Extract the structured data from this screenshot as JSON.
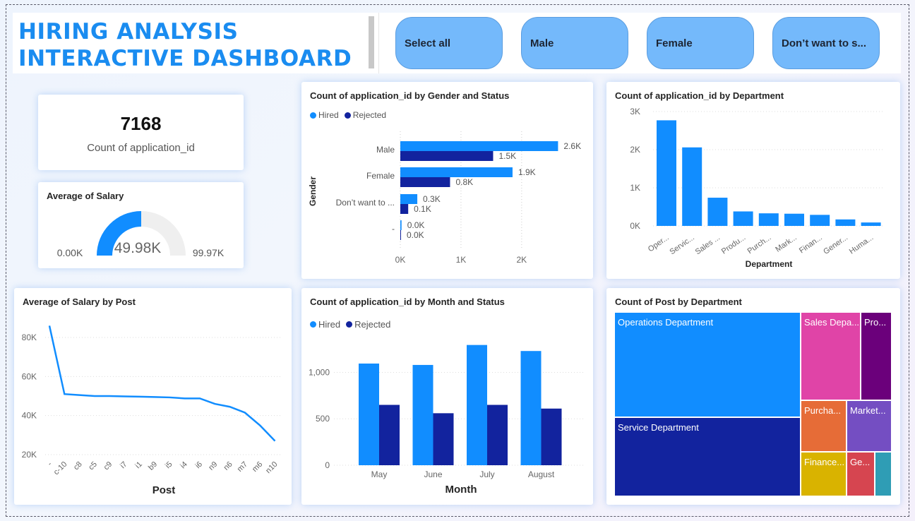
{
  "header": {
    "title_line1": "HIRING ANALYSIS",
    "title_line2": "INTERACTIVE DASHBOARD",
    "slicers": [
      "Select all",
      "Male",
      "Female",
      "Don’t want to s..."
    ]
  },
  "kpi": {
    "value": "7168",
    "label": "Count of application_id"
  },
  "colors": {
    "hired": "#118dff",
    "rejected": "#12239e",
    "accent": "#1a8cf0",
    "gauge_track": "#efefef"
  },
  "chart_data": [
    {
      "type": "gauge",
      "title": "Average of Salary",
      "value": 49.98,
      "min": 0,
      "max": 99.97,
      "value_label": "49.98K",
      "min_label": "0.00K",
      "max_label": "99.97K"
    },
    {
      "type": "bar",
      "orientation": "horizontal",
      "title": "Count of application_id by Gender and Status",
      "ylabel": "Gender",
      "categories": [
        "Male",
        "Female",
        "Don’t want to ...",
        "-"
      ],
      "series": [
        {
          "name": "Hired",
          "values": [
            2600,
            1850,
            280,
            20
          ],
          "labels": [
            "2.6K",
            "1.9K",
            "0.3K",
            "0.0K"
          ]
        },
        {
          "name": "Rejected",
          "values": [
            1530,
            820,
            130,
            10
          ],
          "labels": [
            "1.5K",
            "0.8K",
            "0.1K",
            "0.0K"
          ]
        }
      ],
      "xticks": [
        "0K",
        "1K",
        "2K"
      ],
      "xlim": [
        0,
        2600
      ]
    },
    {
      "type": "bar",
      "title": "Count of application_id by Department",
      "xlabel": "Department",
      "categories": [
        "Oper...",
        "Servic...",
        "Sales ...",
        "Produ...",
        "Purch...",
        "Mark...",
        "Finan...",
        "Gener...",
        "Huma..."
      ],
      "values": [
        2770,
        2060,
        740,
        380,
        330,
        320,
        290,
        170,
        90
      ],
      "yticks": [
        "0K",
        "1K",
        "2K",
        "3K"
      ],
      "ylim": [
        0,
        3000
      ]
    },
    {
      "type": "line",
      "title": "Average of Salary by Post",
      "xlabel": "Post",
      "categories": [
        "-",
        "c-10",
        "c8",
        "c5",
        "c9",
        "i7",
        "i1",
        "b9",
        "i5",
        "i4",
        "i6",
        "n9",
        "n6",
        "m7",
        "m6",
        "n10"
      ],
      "values": [
        86000,
        51000,
        50500,
        50000,
        50000,
        49800,
        49700,
        49500,
        49300,
        48800,
        48800,
        46000,
        44500,
        41500,
        35000,
        27000
      ],
      "yticks": [
        "20K",
        "40K",
        "60K",
        "80K"
      ],
      "ylim": [
        20000,
        85000
      ]
    },
    {
      "type": "bar",
      "title": "Count of application_id by Month and Status",
      "xlabel": "Month",
      "categories": [
        "May",
        "June",
        "July",
        "August"
      ],
      "series": [
        {
          "name": "Hired",
          "values": [
            1095,
            1080,
            1295,
            1230
          ]
        },
        {
          "name": "Rejected",
          "values": [
            650,
            560,
            650,
            610
          ]
        }
      ],
      "yticks": [
        "0",
        "500",
        "1,000"
      ],
      "ylim": [
        0,
        1300
      ]
    },
    {
      "type": "treemap",
      "title": "Count of Post by Department",
      "cells": [
        {
          "label": "Operations Department",
          "color": "#118dff"
        },
        {
          "label": "Service Department",
          "color": "#12239e"
        },
        {
          "label": "Sales Depa...",
          "color": "#e044a7"
        },
        {
          "label": "Pro...",
          "color": "#6b007b"
        },
        {
          "label": "Purcha...",
          "color": "#e66c37"
        },
        {
          "label": "Market...",
          "color": "#744ec2"
        },
        {
          "label": "Finance...",
          "color": "#d9b300"
        },
        {
          "label": "Ge...",
          "color": "#d64550"
        },
        {
          "label": "",
          "color": "#2f9db5"
        }
      ]
    }
  ]
}
